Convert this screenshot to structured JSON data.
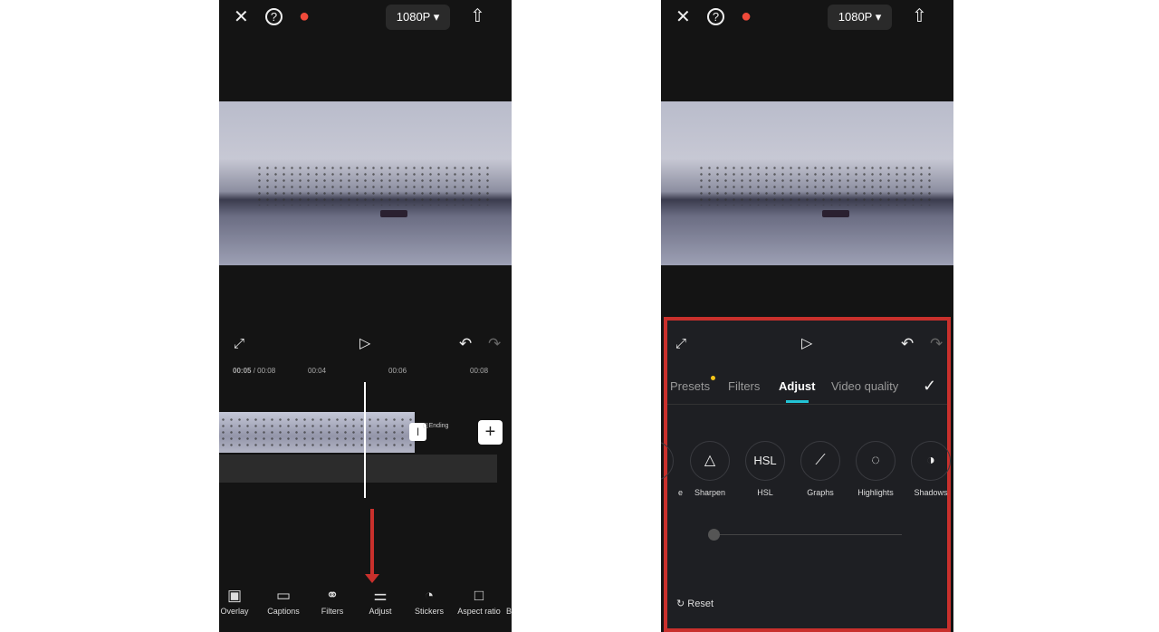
{
  "header": {
    "resolution": "1080P",
    "icons": [
      "close-icon",
      "help-icon",
      "flame-icon",
      "export-icon"
    ]
  },
  "timeline": {
    "current": "00:05",
    "total": "/ 00:08",
    "ticks": [
      "00:04",
      "00:06",
      "00:08"
    ],
    "ending_label": "Ending"
  },
  "toolbar": [
    {
      "label": "Overlay",
      "icon": "▣"
    },
    {
      "label": "Captions",
      "icon": "▭"
    },
    {
      "label": "Filters",
      "icon": "⚭"
    },
    {
      "label": "Adjust",
      "icon": "⚌"
    },
    {
      "label": "Stickers",
      "icon": "◔"
    },
    {
      "label": "Aspect ratio",
      "icon": "□"
    },
    {
      "label": "B",
      "icon": ""
    }
  ],
  "adjust_panel": {
    "tabs": [
      "Presets",
      "Filters",
      "Adjust",
      "Video quality"
    ],
    "active_tab": "Adjust",
    "options": [
      {
        "label": "e",
        "icon": ""
      },
      {
        "label": "Sharpen",
        "icon": "△"
      },
      {
        "label": "HSL",
        "icon": "HSL"
      },
      {
        "label": "Graphs",
        "icon": "⟋"
      },
      {
        "label": "Highlights",
        "icon": "◌"
      },
      {
        "label": "Shadows",
        "icon": "◑"
      }
    ],
    "slider_value": 0,
    "reset_label": "Reset"
  },
  "colors": {
    "highlight": "#c9302c",
    "accent": "#23c4d6",
    "badge": "#f5c518"
  }
}
